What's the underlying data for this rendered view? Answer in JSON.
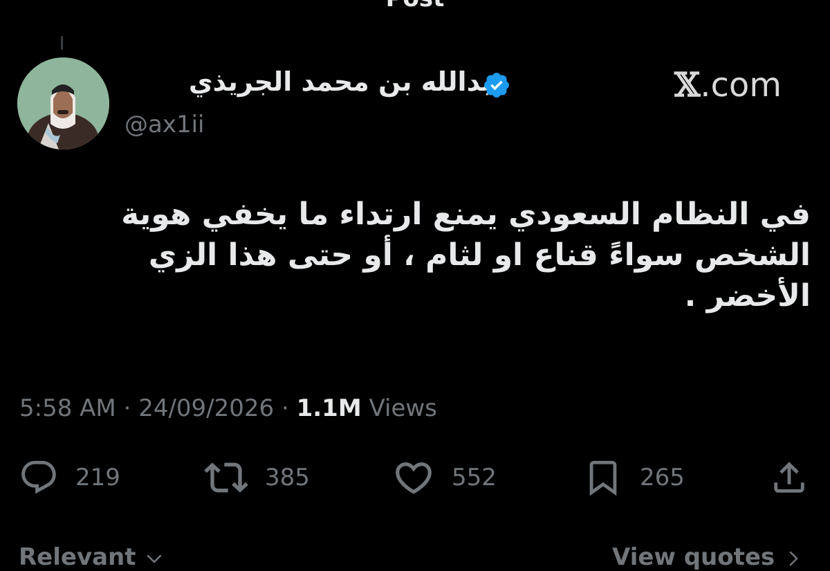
{
  "header": {
    "title": "Post"
  },
  "author": {
    "name": "عبدالله بن محمد الجريذي",
    "handle": "@ax1ii",
    "verified": true,
    "avatar_icon": "profile-photo"
  },
  "source_mark": {
    "x": "𝕏",
    "domain": ".com"
  },
  "tweet": {
    "text": "في النظام السعودي يمنع ارتداء ما يخفي هوية الشخص سواءً قناع او لثام ، أو حتى هذا الزي الأخضر ."
  },
  "meta": {
    "time": "5:58 AM",
    "separator": " · ",
    "date": "24/09/2026",
    "views_count": "1.1M",
    "views_label": " Views"
  },
  "actions": {
    "replies": "219",
    "reposts": "385",
    "likes": "552",
    "bookmarks": "265"
  },
  "footer": {
    "sort_label": "Relevant",
    "view_quotes_label": "View quotes"
  },
  "colors": {
    "background": "#000000",
    "text_primary": "#e7e9ea",
    "text_secondary": "#71767b",
    "verified_blue": "#1d9bf0"
  }
}
